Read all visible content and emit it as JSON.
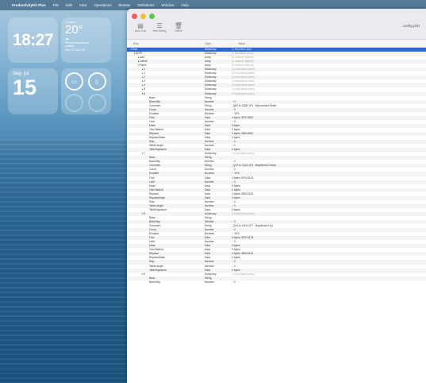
{
  "menubar": {
    "apple": "",
    "app_name": "ProductivityKit Plus",
    "items": [
      "File",
      "Edit",
      "View",
      "Operations",
      "Browse",
      "Definitions",
      "Window",
      "Help"
    ]
  },
  "widgets": {
    "clock": {
      "time": "18:27"
    },
    "weather": {
      "location": "Location",
      "temp": "20°",
      "condition_icon": "☁",
      "lines": [
        "Predominantemente",
        "nublado",
        "Máx 23° Mín 18°"
      ]
    },
    "date": {
      "weekday": "Seg. jul.",
      "day": "15"
    }
  },
  "window": {
    "filename": "config.plist",
    "toolbar": [
      {
        "icon": "▤",
        "label": "New Child"
      },
      {
        "icon": "☰",
        "label": "New Sibling"
      },
      {
        "icon": "🗑",
        "label": "Delete"
      }
    ],
    "columns": {
      "key": "Key",
      "type": "Type",
      "value": "Value"
    },
    "rows": [
      {
        "key": "Root",
        "type": "Dictionary",
        "value": "(1 key/value pair)",
        "indent": 0,
        "disc": "▾",
        "muted": true,
        "selected": true
      },
      {
        "key": "ACPI",
        "type": "Dictionary",
        "value": "(7 key/value pairs)",
        "indent": 1,
        "disc": "▾",
        "muted": true
      },
      {
        "key": "Add",
        "type": "Array",
        "value": "(9 ordered objects)",
        "indent": 2,
        "disc": "▸",
        "muted": true
      },
      {
        "key": "Delete",
        "type": "Array",
        "value": "(0 ordered objects)",
        "indent": 2,
        "disc": "▸",
        "muted": true
      },
      {
        "key": "Patch",
        "type": "Array",
        "value": "(9 ordered objects)",
        "indent": 2,
        "disc": "▾",
        "muted": true
      },
      {
        "key": "0",
        "type": "Dictionary",
        "value": "(14 key/value pairs)",
        "indent": 3,
        "disc": "▸",
        "muted": true
      },
      {
        "key": "1",
        "type": "Dictionary",
        "value": "(14 key/value pairs)",
        "indent": 3,
        "disc": "▸",
        "muted": true
      },
      {
        "key": "2",
        "type": "Dictionary",
        "value": "(14 key/value pairs)",
        "indent": 3,
        "disc": "▸",
        "muted": true
      },
      {
        "key": "3",
        "type": "Dictionary",
        "value": "(14 key/value pairs)",
        "indent": 3,
        "disc": "▸",
        "muted": true
      },
      {
        "key": "4",
        "type": "Dictionary",
        "value": "(14 key/value pairs)",
        "indent": 3,
        "disc": "▸",
        "muted": true
      },
      {
        "key": "5",
        "type": "Dictionary",
        "value": "(14 key/value pairs)",
        "indent": 3,
        "disc": "▸",
        "muted": true
      },
      {
        "key": "6",
        "type": "Dictionary",
        "value": "(14 key/value pairs)",
        "indent": 3,
        "disc": "▾",
        "muted": true
      },
      {
        "key": "Base",
        "type": "String",
        "value": "",
        "indent": 4
      },
      {
        "key": "BaseSkip",
        "type": "Number",
        "value": "0",
        "indent": 4,
        "step": true
      },
      {
        "key": "Comment",
        "type": "String",
        "value": "_Q82 to XQ82 (F5 - Microphone Mute)",
        "indent": 4
      },
      {
        "key": "Count",
        "type": "Number",
        "value": "0",
        "indent": 4,
        "step": true
      },
      {
        "key": "Enabled",
        "type": "Boolean",
        "value": "YES",
        "indent": 4,
        "step": true
      },
      {
        "key": "Find",
        "type": "Data",
        "value": "4 bytes: 5F513832",
        "indent": 4
      },
      {
        "key": "Limit",
        "type": "Number",
        "value": "0",
        "indent": 4,
        "step": true
      },
      {
        "key": "Mask",
        "type": "Data",
        "value": "0 bytes",
        "indent": 4
      },
      {
        "key": "OemTableId",
        "type": "Data",
        "value": "0 bytes",
        "indent": 4
      },
      {
        "key": "Replace",
        "type": "Data",
        "value": "4 bytes: 58513832",
        "indent": 4
      },
      {
        "key": "ReplaceMask",
        "type": "Data",
        "value": "0 bytes",
        "indent": 4
      },
      {
        "key": "Skip",
        "type": "Number",
        "value": "0",
        "indent": 4,
        "step": true
      },
      {
        "key": "TableLength",
        "type": "Number",
        "value": "0",
        "indent": 4,
        "step": true
      },
      {
        "key": "TableSignature",
        "type": "Data",
        "value": "0 bytes",
        "indent": 4
      },
      {
        "key": "7",
        "type": "Dictionary",
        "value": "(14 key/value pairs)",
        "indent": 3,
        "disc": "▾",
        "muted": true
      },
      {
        "key": "Base",
        "type": "String",
        "value": "",
        "indent": 4
      },
      {
        "key": "BaseSkip",
        "type": "Number",
        "value": "0",
        "indent": 4,
        "step": true
      },
      {
        "key": "Comment",
        "type": "String",
        "value": "_Q13 to XQ13 (F6 - Brightness Down)",
        "indent": 4
      },
      {
        "key": "Count",
        "type": "Number",
        "value": "0",
        "indent": 4,
        "step": true
      },
      {
        "key": "Enabled",
        "type": "Boolean",
        "value": "YES",
        "indent": 4,
        "step": true
      },
      {
        "key": "Find",
        "type": "Data",
        "value": "4 bytes: 5F513133",
        "indent": 4
      },
      {
        "key": "Limit",
        "type": "Number",
        "value": "0",
        "indent": 4,
        "step": true
      },
      {
        "key": "Mask",
        "type": "Data",
        "value": "0 bytes",
        "indent": 4
      },
      {
        "key": "OemTableId",
        "type": "Data",
        "value": "0 bytes",
        "indent": 4
      },
      {
        "key": "Replace",
        "type": "Data",
        "value": "4 bytes: 58513133",
        "indent": 4
      },
      {
        "key": "ReplaceMask",
        "type": "Data",
        "value": "0 bytes",
        "indent": 4
      },
      {
        "key": "Skip",
        "type": "Number",
        "value": "0",
        "indent": 4,
        "step": true
      },
      {
        "key": "TableLength",
        "type": "Number",
        "value": "0",
        "indent": 4,
        "step": true
      },
      {
        "key": "TableSignature",
        "type": "Data",
        "value": "0 bytes",
        "indent": 4
      },
      {
        "key": "8",
        "type": "Dictionary",
        "value": "(14 key/value pairs)",
        "indent": 3,
        "disc": "▾",
        "muted": true
      },
      {
        "key": "Base",
        "type": "String",
        "value": "",
        "indent": 4
      },
      {
        "key": "BaseSkip",
        "type": "Number",
        "value": "0",
        "indent": 4,
        "step": true
      },
      {
        "key": "Comment",
        "type": "String",
        "value": "_Q14 to XQ14 (F7 - Brightness Up)",
        "indent": 4
      },
      {
        "key": "Count",
        "type": "Number",
        "value": "0",
        "indent": 4,
        "step": true
      },
      {
        "key": "Enabled",
        "type": "Boolean",
        "value": "YES",
        "indent": 4,
        "step": true
      },
      {
        "key": "Find",
        "type": "Data",
        "value": "4 bytes: 5F513134",
        "indent": 4
      },
      {
        "key": "Limit",
        "type": "Number",
        "value": "0",
        "indent": 4,
        "step": true
      },
      {
        "key": "Mask",
        "type": "Data",
        "value": "0 bytes",
        "indent": 4
      },
      {
        "key": "OemTableId",
        "type": "Data",
        "value": "0 bytes",
        "indent": 4
      },
      {
        "key": "Replace",
        "type": "Data",
        "value": "4 bytes: 58513134",
        "indent": 4
      },
      {
        "key": "ReplaceMask",
        "type": "Data",
        "value": "0 bytes",
        "indent": 4
      },
      {
        "key": "Skip",
        "type": "Number",
        "value": "0",
        "indent": 4,
        "step": true
      },
      {
        "key": "TableLength",
        "type": "Number",
        "value": "0",
        "indent": 4,
        "step": true
      },
      {
        "key": "TableSignature",
        "type": "Data",
        "value": "0 bytes",
        "indent": 4
      },
      {
        "key": "9",
        "type": "Dictionary",
        "value": "(14 key/value pairs)",
        "indent": 3,
        "disc": "▾",
        "muted": true
      },
      {
        "key": "Base",
        "type": "String",
        "value": "",
        "indent": 4
      },
      {
        "key": "BaseSkip",
        "type": "Number",
        "value": "0",
        "indent": 4,
        "step": true
      }
    ]
  }
}
